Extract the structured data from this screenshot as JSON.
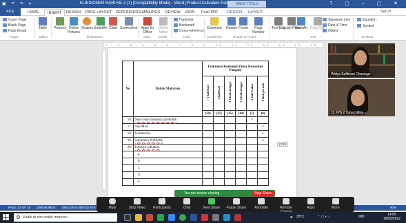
{
  "window": {
    "title": "KUESIONER HARI KE-2 (1) [Compatibility Mode] - Word (Product Activation Failed)",
    "context_group": "TABLE TOOLS",
    "sign_in": "Sign in"
  },
  "tabs": [
    "FILE",
    "HOME",
    "INSERT",
    "DESIGN",
    "PAGE LAYOUT",
    "REFERENCES",
    "MAILINGS",
    "REVIEW",
    "VIEW",
    "Foxit PDF",
    "DESIGN",
    "LAYOUT"
  ],
  "ribbon": {
    "pages": [
      "Cover Page",
      "Blank Page",
      "Page Break"
    ],
    "buttons": [
      "Table",
      "Pictures",
      "Online Pictures",
      "Shapes",
      "SmartArt",
      "Chart",
      "Screenshot",
      "Apps for Office",
      "Online Video",
      "Comment",
      "Header",
      "Footer",
      "Page Number",
      "Text Box",
      "Quick Parts",
      "WordArt",
      "Drop Cap"
    ],
    "links": [
      "Hyperlink",
      "Bookmark",
      "Cross-reference"
    ],
    "text_small": [
      "Signature Line",
      "Date & Time",
      "Object"
    ],
    "symbols": [
      "Equation",
      "Symbol"
    ],
    "groups": [
      "Pages",
      "Tables",
      "Illustrations",
      "Apps",
      "Media",
      "Links",
      "Comments",
      "Header & Footer",
      "Text",
      "Symbols"
    ]
  },
  "ruler_text": "1 · 2 · 3 · 4 · 5 · 6 · 7 · 8 · 9 · 10 · 11 · 12 · 13 · 14 · 15 · 16 · 17",
  "table": {
    "col_no": "No",
    "col_food": "Bahan Makanan",
    "freq_header": "Frekuensi Konsumsi (Skor Konsumsi Pangan)",
    "freq_cols": [
      "> 1 kali/hari",
      "1 kali/hari",
      "3-6 kali/minggu",
      "1-2 kali/minggu",
      "2 kali/ bulan",
      "Tidak pernah"
    ],
    "scores": [
      "(50)",
      "(25)",
      "(15)",
      "(10)",
      "(5)",
      "(0)"
    ],
    "rows": [
      {
        "no": "16.",
        "name": "Susu buah minuman probiotik",
        "marks": [
          "",
          "",
          "",
          "",
          "v",
          ""
        ]
      },
      {
        "no": "17.",
        "name": "Sup Miso",
        "marks": [
          "",
          "",
          "",
          "",
          "",
          "v"
        ]
      },
      {
        "no": "18.",
        "name": "Kombucha",
        "marks": [
          "",
          "",
          "",
          "",
          "",
          "v"
        ]
      },
      {
        "no": "19.",
        "name": "Suplemen Probiotik",
        "marks": [
          "",
          "",
          "",
          "",
          "",
          "v"
        ]
      },
      {
        "no": "20.",
        "name": "Lainnya sebutkan",
        "marks": [
          "",
          "",
          "",
          "",
          "",
          ""
        ]
      },
      {
        "no": "",
        "name": "a.",
        "marks": [
          "",
          "",
          "",
          "",
          "",
          ""
        ]
      },
      {
        "no": "",
        "name": "b.",
        "marks": [
          "",
          "",
          "",
          "",
          "",
          ""
        ]
      },
      {
        "no": "",
        "name": "c.",
        "marks": [
          "",
          "",
          "",
          "",
          "",
          ""
        ]
      },
      {
        "no": "",
        "name": "d.",
        "marks": [
          "",
          "",
          "",
          "",
          "",
          ""
        ]
      },
      {
        "no": "",
        "name": "e.",
        "marks": [
          "",
          "",
          "",
          "",
          "",
          ""
        ]
      }
    ],
    "ctrl_tag": "(Ctrl)"
  },
  "participants": [
    {
      "name": "Widya Safitriani Chaniago"
    },
    {
      "name": "11. IPS 2 Tuha Difitra"
    }
  ],
  "share_banner": {
    "text": "You are screen sharing",
    "stop": "Stop Share"
  },
  "status": {
    "page": "PAGE 13 OF 25",
    "words": "1788 WORDS",
    "lang": "ENGLISH (UNITED STATES)",
    "zoom": "90%"
  },
  "zoom_toolbar": [
    "Mute",
    "Stop Video",
    "Participants",
    "Chat",
    "New Share",
    "Pause Share",
    "Annotate",
    "Remote Control",
    "Apps",
    "More"
  ],
  "participants_count": "2",
  "taskbar": {
    "search_placeholder": "Ketik di sini untuk mencari",
    "weather": "30°C",
    "lang": "IND",
    "time": "14:05",
    "date": "19/02/2022"
  },
  "colors": {
    "word_blue": "#2b579a",
    "share_green": "#2d8a3e",
    "stop_red": "#e02828",
    "zoom_bar": "#1f1f1f",
    "taskbar": "#1c2433"
  }
}
